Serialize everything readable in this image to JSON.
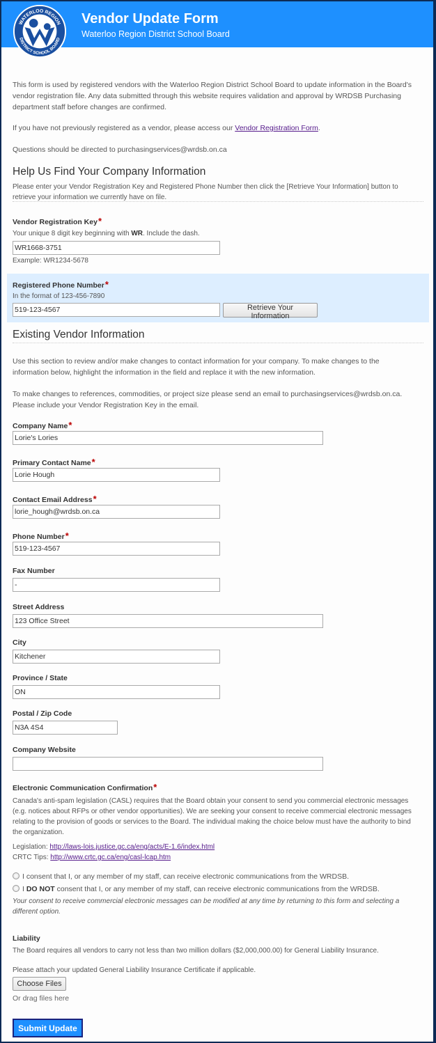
{
  "header": {
    "title": "Vendor Update Form",
    "subtitle": "Waterloo Region District School Board",
    "logo": {
      "icon": "wrdsb-logo",
      "top_text": "WATERLOO REGION",
      "bottom_text": "DISTRICT SCHOOL BOARD"
    },
    "bg_color": "#1e90ff"
  },
  "intro": {
    "paragraph1": "This form is used by registered vendors with the Waterloo Region District School Board to update information in the Board's vendor registration file. Any data submitted through this website requires validation and approval by WRDSB Purchasing department staff before changes are confirmed.",
    "paragraph2_prefix": "If you have not previously registered as a vendor, please access our ",
    "paragraph2_link": "Vendor Registration Form",
    "paragraph2_suffix": ".",
    "paragraph3": "Questions should be directed to purchasingservices@wrdsb.on.ca"
  },
  "find_section": {
    "heading": "Help Us Find Your Company Information",
    "description": "Please enter your Vendor Registration Key and Registered Phone Number then click the [Retrieve Your Information] button to retrieve your information we currently have on file.",
    "key_field": {
      "label": "Vendor Registration Key",
      "required_mark": "*",
      "hint_prefix": "Your unique 8 digit key beginning with ",
      "hint_bold": "WR",
      "hint_suffix": ". Include the dash.",
      "value": "WR1668-3751",
      "example": "Example: WR1234-5678"
    },
    "phone_field": {
      "label": "Registered Phone Number",
      "required_mark": "*",
      "hint": "In the format of 123-456-7890",
      "value": "519-123-4567"
    },
    "retrieve_button": "Retrieve Your Information"
  },
  "existing_section": {
    "heading": "Existing Vendor Information",
    "paragraph1": "Use this section to review and/or make changes to contact information for your company. To make changes to the information below, highlight the information in the field and replace it with the new information.",
    "paragraph2": "To make changes to references, commodities, or project size please send an email to purchasingservices@wrdsb.on.ca. Please include your Vendor Registration Key in the email.",
    "fields": [
      {
        "label": "Company Name",
        "required": "*",
        "value": "Lorie's Lories"
      },
      {
        "label": "Primary Contact Name",
        "required": "*",
        "value": "Lorie Hough"
      },
      {
        "label": "Contact Email Address",
        "required": "*",
        "value": "lorie_hough@wrdsb.on.ca"
      },
      {
        "label": "Phone Number",
        "required": "*",
        "value": "519-123-4567"
      },
      {
        "label": "Fax Number",
        "required": "",
        "value": "-"
      },
      {
        "label": "Street Address",
        "required": "",
        "value": "123 Office Street"
      },
      {
        "label": "City",
        "required": "",
        "value": "Kitchener"
      },
      {
        "label": "Province / State",
        "required": "",
        "value": "ON"
      },
      {
        "label": "Postal / Zip Code",
        "required": "",
        "value": "N3A 4S4"
      },
      {
        "label": "Company Website",
        "required": "",
        "value": ""
      }
    ]
  },
  "casl": {
    "label": "Electronic Communication Confirmation",
    "required_mark": "*",
    "description": "Canada's anti-spam legislation (CASL) requires that the Board obtain your consent to send you commercial electronic messages (e.g. notices about RFPs or other vendor opportunities). We are seeking your consent to receive commercial electronic messages relating to the provision of goods or services to the Board. The individual making the choice below must have the authority to bind the organization.",
    "legislation_label": "Legislation: ",
    "legislation_link": "http://laws-lois.justice.gc.ca/eng/acts/E-1.6/index.html",
    "crtc_label": "CRTC Tips: ",
    "crtc_link": "http://www.crtc.gc.ca/eng/casl-lcap.htm",
    "options": [
      {
        "prefix": "",
        "bold": "",
        "text": "I consent that I, or any member of my staff, can receive electronic communications from the WRDSB.",
        "selected": false
      },
      {
        "prefix": "I ",
        "bold": "DO NOT",
        "text": " consent that I, or any member of my staff, can receive electronic communications from the WRDSB.",
        "selected": false
      }
    ],
    "note": "Your consent to receive commercial electronic messages can be modified at any time by returning to this form and selecting a different option."
  },
  "liability": {
    "label": "Liability",
    "description": "The Board requires all vendors to carry not less than two million dollars ($2,000,000.00) for General Liability Insurance.",
    "attach_text": "Please attach your updated General Liability Insurance Certificate if applicable.",
    "choose_files_button": "Choose Files",
    "drag_text": "Or drag files here"
  },
  "submit_button": "Submit Update"
}
